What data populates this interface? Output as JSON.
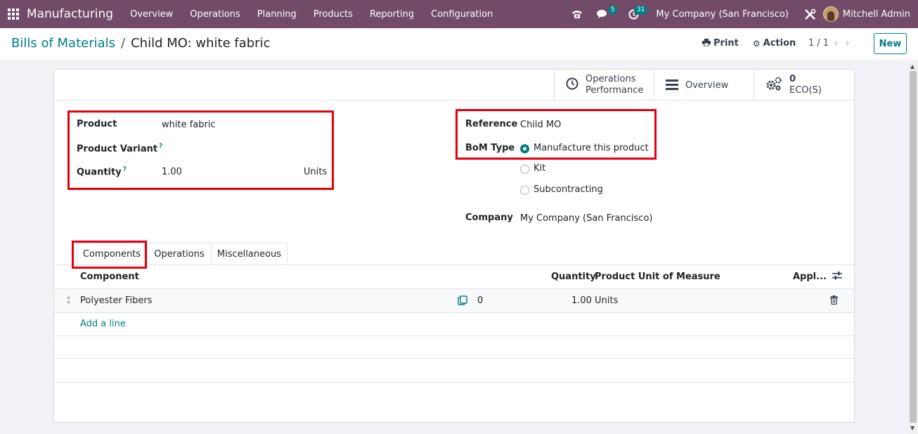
{
  "navbar": {
    "app_name": "Manufacturing",
    "menu": [
      "Overview",
      "Operations",
      "Planning",
      "Products",
      "Reporting",
      "Configuration"
    ],
    "messages_badge": "5",
    "activities_badge": "31",
    "company": "My Company (San Francisco)",
    "user": "Mitchell Admin"
  },
  "breadcrumb": {
    "parent": "Bills of Materials",
    "separator": "/",
    "current": "Child MO: white fabric"
  },
  "control": {
    "print_label": "Print",
    "action_label": "Action",
    "pager": "1 / 1",
    "new_label": "New"
  },
  "smart_buttons": {
    "ops_line1": "Operations",
    "ops_line2": "Performance",
    "overview": "Overview",
    "eco_count": "0",
    "eco_label": "ECO(S)"
  },
  "form": {
    "product_label": "Product",
    "product_value": "white fabric",
    "variant_label": "Product Variant",
    "quantity_label": "Quantity",
    "quantity_value": "1.00",
    "quantity_uom": "Units",
    "reference_label": "Reference",
    "reference_value": "Child MO",
    "bom_type_label": "BoM Type",
    "bom_type_options": [
      "Manufacture this product",
      "Kit",
      "Subcontracting"
    ],
    "bom_type_selected": "Manufacture this product",
    "company_label": "Company",
    "company_value": "My Company (San Francisco)",
    "tooltip_mark": "?"
  },
  "tabs": [
    "Components",
    "Operations",
    "Miscellaneous"
  ],
  "components_table": {
    "headers": {
      "component": "Component",
      "quantity": "Quantity",
      "uom": "Product Unit of Measure",
      "applicable": "Appl..."
    },
    "rows": [
      {
        "component": "Polyester Fibers",
        "forecast": "0",
        "quantity": "1.00",
        "uom": "Units"
      }
    ],
    "add_line": "Add a line"
  },
  "colors": {
    "navbar": "#714b67",
    "accent": "#017e84",
    "highlight": "#e5000e"
  }
}
